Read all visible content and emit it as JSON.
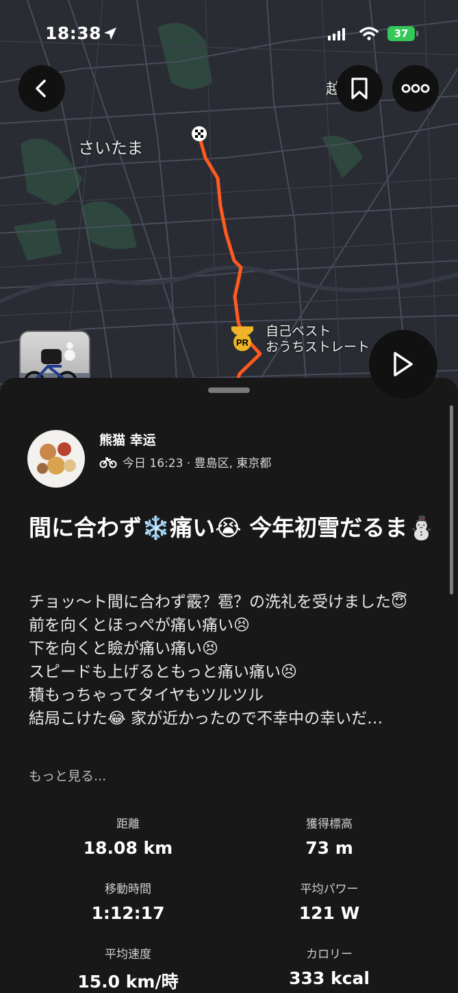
{
  "status_bar": {
    "time": "18:38",
    "battery": "37"
  },
  "map": {
    "city_label": "さいたま",
    "corner_label": "越",
    "pr_label_line1": "自己ベスト",
    "pr_label_line2": "おうちストレート",
    "pr_badge_text": "PR"
  },
  "post": {
    "user_name": "熊猫 幸运",
    "meta": "今日 16:23 · 豊島区, 東京都",
    "title": "間に合わず❄️痛い😭 今年初雪だるま⛄",
    "description_lines": [
      "チョッ〜ト間に合わず霰？雹？の洗礼を受けました😇",
      "前を向くとほっぺが痛い痛い😣",
      "下を向くと瞼が痛い痛い😣",
      "スピードも上げるともっと痛い痛い😣",
      "積もっちゃってタイヤもツルツル",
      "結局こけた😂 家が近かったので不幸中の幸いだ…"
    ],
    "see_more": "もっと見る..."
  },
  "stats": [
    {
      "label": "距離",
      "value": "18.08 km"
    },
    {
      "label": "獲得標高",
      "value": "73 m"
    },
    {
      "label": "移動時間",
      "value": "1:12:17"
    },
    {
      "label": "平均パワー",
      "value": "121 W"
    },
    {
      "label": "平均速度",
      "value": "15.0 km/時"
    },
    {
      "label": "カロリー",
      "value": "333 kcal"
    }
  ],
  "colors": {
    "route": "#ff5a1f",
    "pr_badge": "#f0b429",
    "battery": "#34c759"
  },
  "icons": [
    "location-arrow-icon",
    "signal-icon",
    "wifi-icon",
    "back-chevron-icon",
    "bookmark-icon",
    "more-dots-icon",
    "play-icon",
    "finish-flag-icon",
    "pr-badge-icon",
    "bike-icon"
  ]
}
